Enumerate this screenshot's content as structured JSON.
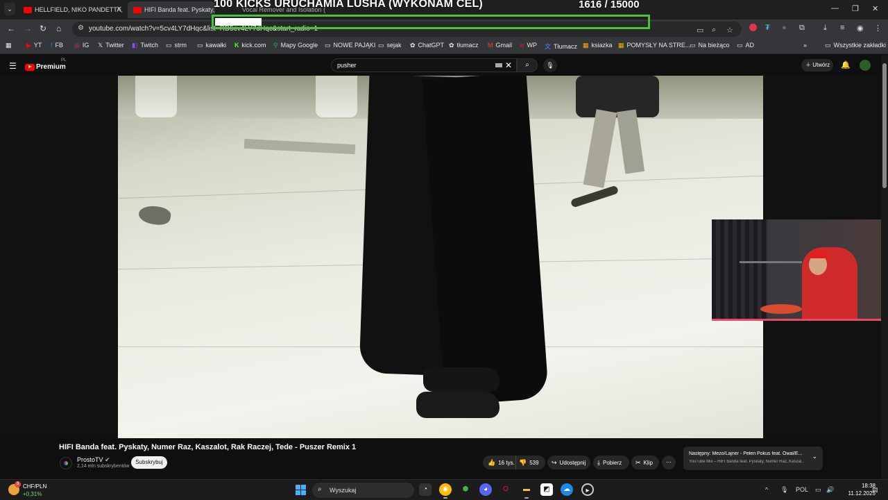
{
  "browser": {
    "tabs": [
      {
        "title": "HELLFIELD, NIKO PANDETTA, M"
      },
      {
        "title": "HIFI Banda feat. Pyskaty, Num"
      },
      {
        "title": "Vocal Remover and Isolation ("
      }
    ],
    "url": "youtube.com/watch?v=5cv4LY7dHqc&list=RD5cv4LY7dHqc&start_radio=1",
    "bookmarks": [
      {
        "label": "YT",
        "icon": "youtube-icon"
      },
      {
        "label": "FB",
        "icon": "facebook-icon"
      },
      {
        "label": "IG",
        "icon": "instagram-icon"
      },
      {
        "label": "Twitter",
        "icon": "x-icon"
      },
      {
        "label": "Twitch",
        "icon": "twitch-icon"
      },
      {
        "label": "strm",
        "icon": "folder-icon"
      },
      {
        "label": "kawałki",
        "icon": "folder-icon"
      },
      {
        "label": "kick.com",
        "icon": "kick-icon"
      },
      {
        "label": "Mapy Google",
        "icon": "maps-icon"
      },
      {
        "label": "NOWE PAJĄKI",
        "icon": "folder-icon"
      },
      {
        "label": "sejak",
        "icon": "folder-icon"
      },
      {
        "label": "ChatGPT",
        "icon": "chatgpt-icon"
      },
      {
        "label": "tłumacz",
        "icon": "chatgpt-icon"
      },
      {
        "label": "Gmail",
        "icon": "gmail-icon"
      },
      {
        "label": "WP",
        "icon": "wp-icon"
      },
      {
        "label": "Tłumacz",
        "icon": "translate-icon"
      },
      {
        "label": "ksiazka",
        "icon": "grid-icon"
      },
      {
        "label": "POMYSŁY NA STRE...",
        "icon": "grid-icon"
      },
      {
        "label": "Na bieżąco",
        "icon": "folder-icon"
      },
      {
        "label": "AD",
        "icon": "folder-icon"
      }
    ],
    "all_bookmarks": "Wszystkie zakładki"
  },
  "overlay": {
    "title": "100 KICKS URUCHAMIA LUSHA (WYKONAM CEL)",
    "count": "1616   / 15000",
    "progress": 0.1077
  },
  "youtube": {
    "logo_text": "Premium",
    "region": "PL",
    "search_query": "pusher",
    "create_label": "Utwórz",
    "video": {
      "title": "HIFI Banda feat. Pyskaty, Numer Raz, Kaszalot, Rak Raczej, Tede - Puszer Remix 1",
      "channel": "ProstoTV",
      "subscribers": "2,14 mln subskrybentów",
      "subscribe_label": "Subskrybuj",
      "likes": "16 tys.",
      "dislikes": "539",
      "share_label": "Udostępnij",
      "download_label": "Pobierz",
      "clip_label": "Klip"
    },
    "next_up": {
      "title": "Następny: Mezo/Lajner - Pełen Pokus feat. Owal/E...",
      "subtitle": "YouTube Mix – HIFI Banda feat. Pyskaty, Numer Raz, Kaszal..."
    }
  },
  "taskbar": {
    "ticker_name": "CHF/PLN",
    "ticker_value": "+0,31%",
    "weather_badge": "3",
    "search_label": "Wyszukaj",
    "language": "POL",
    "time": "18:38",
    "date": "11.12.2025"
  },
  "colors": {
    "accent_green": "#4cc13b",
    "youtube_red": "#ff0000",
    "overlay_cam_border": "#e94a63"
  }
}
